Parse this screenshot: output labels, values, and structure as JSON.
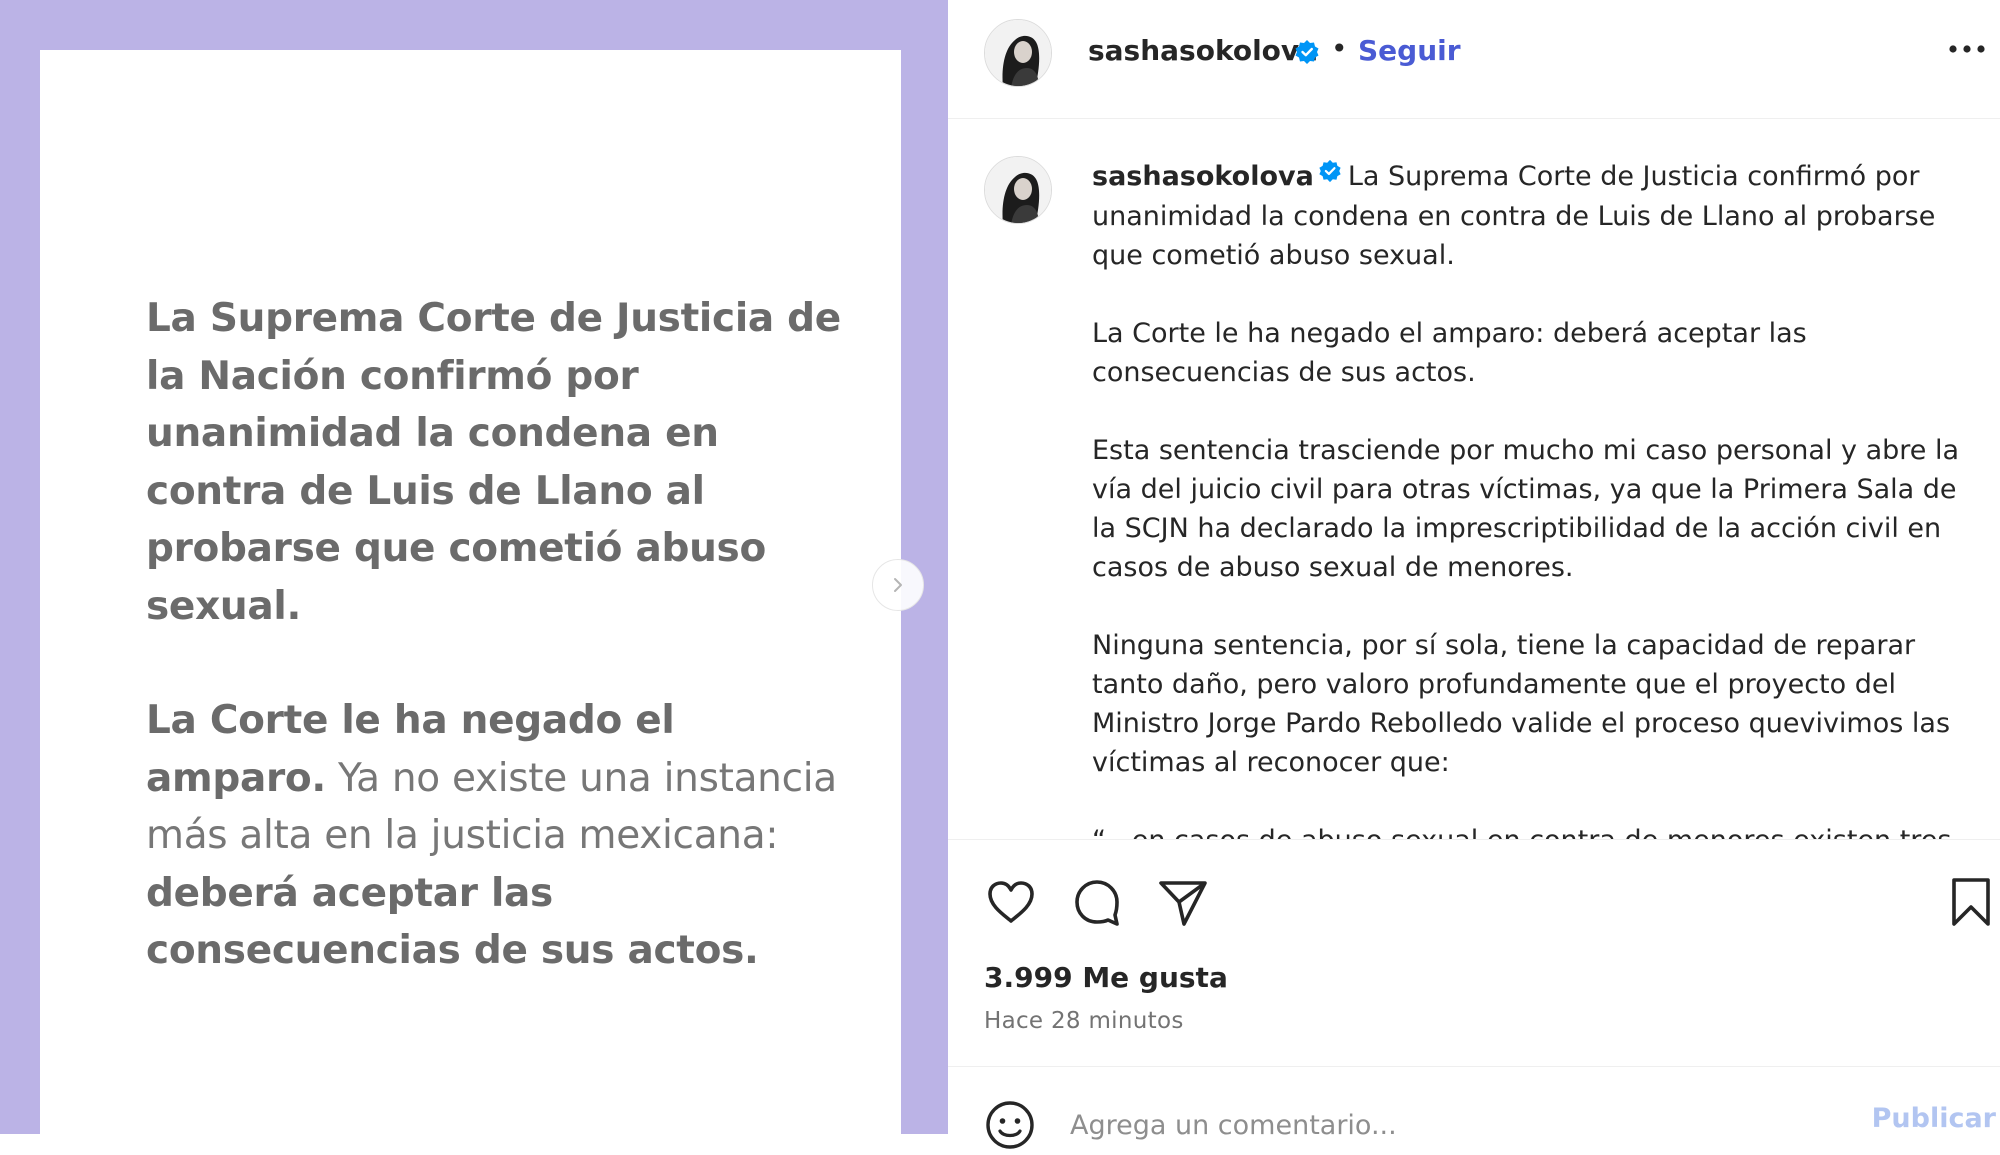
{
  "media": {
    "paragraph1": "La Suprema Corte de Justicia de la Nación confirmó por unanimidad la condena en contra de Luis de Llano al probarse que cometió abuso sexual.",
    "paragraph2_bold_a": "La Corte le ha negado el amparo.",
    "paragraph2_regular": " Ya no existe una instancia más alta en la justicia mexicana: ",
    "paragraph2_bold_b": "deberá aceptar las consecuencias de sus actos."
  },
  "header": {
    "username": "sashasokolova",
    "separator": "•",
    "follow_label": "Seguir"
  },
  "caption": {
    "username": "sashasokolova",
    "paragraphs": [
      "La Suprema Corte de Justicia confirmó por unanimidad la condena en contra de Luis de Llano al probarse que cometió abuso sexual.",
      "La Corte le ha negado el amparo: deberá aceptar las consecuencias de sus actos.",
      "Esta sentencia trasciende por mucho mi caso personal y abre la vía del juicio civil para otras víctimas, ya que la Primera Sala de la SCJN ha declarado la imprescriptibilidad de la acción civil en casos de abuso sexual de menores.",
      "Ninguna sentencia, por sí sola, tiene la capacidad de reparar tanto daño, pero valoro profundamente que el proyecto del Ministro Jorge Pardo Rebolledo valide el proceso quevivimos las víctimas al reconocer que:",
      "“...en casos de abuso sexual en contra de menores existen tres"
    ]
  },
  "engagement": {
    "likes": "3.999 Me gusta",
    "time": "Hace 28 minutos"
  },
  "comment": {
    "placeholder": "Agrega un comentario...",
    "publish_label": "Publicar"
  },
  "colors": {
    "media_background": "#bbb3e6",
    "verified_badge": "#0095f6",
    "follow_link": "#4a5bd4",
    "publish_disabled": "#b2c5f1"
  },
  "icons": [
    "chevron-right-icon",
    "verified-badge-icon",
    "more-options-icon",
    "heart-icon",
    "comment-icon",
    "share-icon",
    "bookmark-icon",
    "emoji-icon"
  ]
}
